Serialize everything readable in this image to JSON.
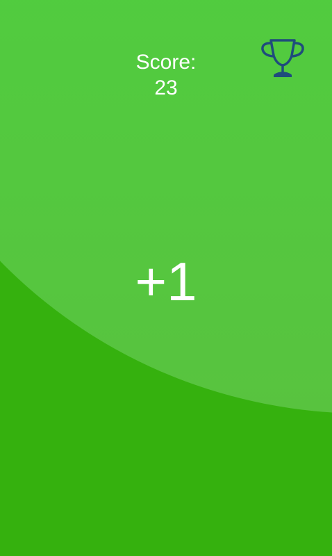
{
  "hud": {
    "score_label": "Score:",
    "score_value": "23",
    "leaderboard_icon": "trophy-icon"
  },
  "game": {
    "popup_text": "+1"
  },
  "colors": {
    "background_dark": "#35b10e",
    "background_light": "#44d43c",
    "trophy": "#1f4c7c",
    "text": "#ffffff"
  }
}
